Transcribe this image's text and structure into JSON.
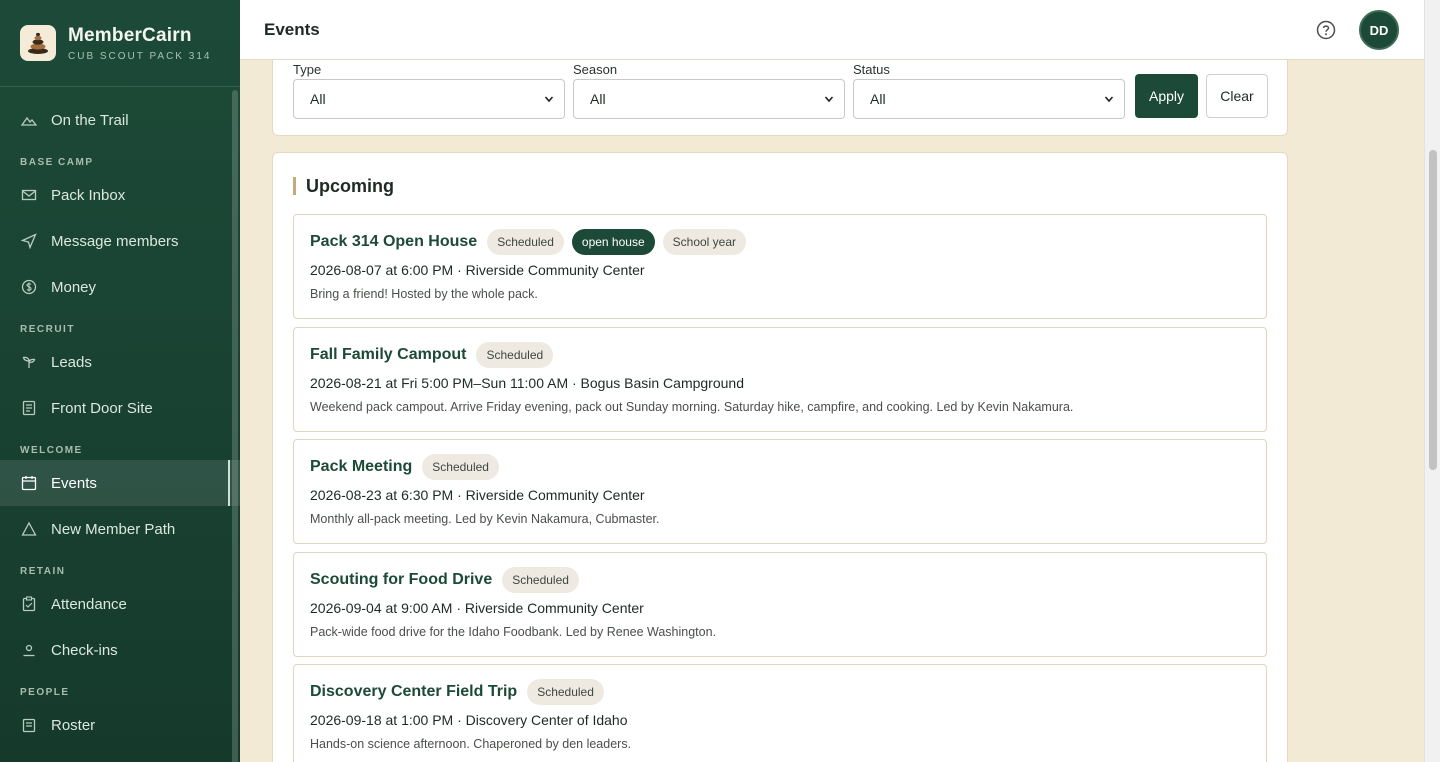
{
  "brand": {
    "name": "MemberCairn",
    "subtitle": "CUB SCOUT PACK 314"
  },
  "nav": {
    "trail": "On the Trail",
    "section_base_camp": "BASE CAMP",
    "pack_inbox": "Pack Inbox",
    "message_members": "Message members",
    "money": "Money",
    "section_recruit": "RECRUIT",
    "leads": "Leads",
    "front_door": "Front Door Site",
    "section_welcome": "WELCOME",
    "events": "Events",
    "new_member_path": "New Member Path",
    "section_retain": "RETAIN",
    "attendance": "Attendance",
    "checkins": "Check-ins",
    "section_people": "PEOPLE",
    "roster": "Roster"
  },
  "header": {
    "title": "Events",
    "avatar_initials": "DD"
  },
  "filters": {
    "type_label": "Type",
    "type_value": "All",
    "season_label": "Season",
    "season_value": "All",
    "status_label": "Status",
    "status_value": "All",
    "apply": "Apply",
    "clear": "Clear"
  },
  "upcoming": {
    "title": "Upcoming",
    "events": [
      {
        "title": "Pack 314 Open House",
        "badges": [
          "Scheduled",
          "open house",
          "School year"
        ],
        "when": "2026-08-07 at 6:00 PM · Riverside Community Center",
        "desc": "Bring a friend! Hosted by the whole pack."
      },
      {
        "title": "Fall Family Campout",
        "badges": [
          "Scheduled"
        ],
        "when": "2026-08-21 at Fri 5:00 PM–Sun 11:00 AM · Bogus Basin Campground",
        "desc": "Weekend pack campout. Arrive Friday evening, pack out Sunday morning. Saturday hike, campfire, and cooking. Led by Kevin Nakamura."
      },
      {
        "title": "Pack Meeting",
        "badges": [
          "Scheduled"
        ],
        "when": "2026-08-23 at 6:30 PM · Riverside Community Center",
        "desc": "Monthly all-pack meeting. Led by Kevin Nakamura, Cubmaster."
      },
      {
        "title": "Scouting for Food Drive",
        "badges": [
          "Scheduled"
        ],
        "when": "2026-09-04 at 9:00 AM · Riverside Community Center",
        "desc": "Pack-wide food drive for the Idaho Foodbank. Led by Renee Washington."
      },
      {
        "title": "Discovery Center Field Trip",
        "badges": [
          "Scheduled"
        ],
        "when": "2026-09-18 at 1:00 PM · Discovery Center of Idaho",
        "desc": "Hands-on science afternoon. Chaperoned by den leaders."
      }
    ]
  }
}
